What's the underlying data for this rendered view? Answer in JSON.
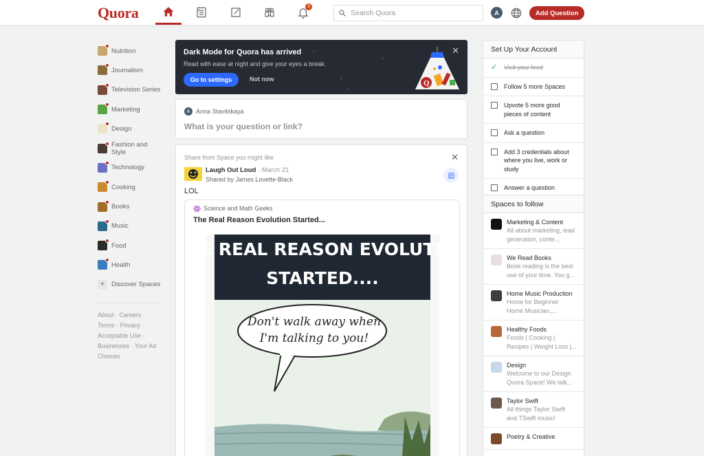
{
  "header": {
    "logo": "Quora",
    "notifications_count": "3",
    "search_placeholder": "Search Quora",
    "avatar_letter": "A",
    "add_question_label": "Add Question"
  },
  "sidebar": {
    "items": [
      {
        "label": "Nutrition",
        "color": "#c9a66b"
      },
      {
        "label": "Journalism",
        "color": "#8a6d3b"
      },
      {
        "label": "Television Series",
        "color": "#7a4b3a"
      },
      {
        "label": "Marketing",
        "color": "#5aa343"
      },
      {
        "label": "Design",
        "color": "#e9e3c9"
      },
      {
        "label": "Fashion and Style",
        "color": "#4a3b34"
      },
      {
        "label": "Technology",
        "color": "#6d6fc4"
      },
      {
        "label": "Cooking",
        "color": "#c88a2e"
      },
      {
        "label": "Books",
        "color": "#a56b2a"
      },
      {
        "label": "Music",
        "color": "#2c6a8f"
      },
      {
        "label": "Food",
        "color": "#2b2b2b"
      },
      {
        "label": "Health",
        "color": "#3b7bbf"
      }
    ],
    "discover_label": "Discover Spaces",
    "footer_links": [
      "About",
      "Careers",
      "Terms",
      "Privacy",
      "Acceptable Use",
      "Businesses",
      "Your Ad Choices"
    ]
  },
  "dark_mode_banner": {
    "title": "Dark Mode for Quora has arrived",
    "description": "Read with ease at night and give your eyes a break.",
    "primary_button": "Go to settings",
    "secondary_button": "Not now"
  },
  "ask_box": {
    "user_name": "Anna Stavitskaya",
    "user_initial": "A",
    "prompt": "What is your question or link?"
  },
  "post": {
    "source": "Share from Space you might like",
    "space_name": "Laugh Out Loud",
    "date": "· March 21",
    "shared_by": "Shared by James Lovette-Black",
    "text": "LOL",
    "inner_space": "Science and Math Geeks",
    "inner_title": "The Real Reason Evolution Started...",
    "comic_caption_line1": "THE REAL REASON EVOLUTION",
    "comic_caption_line2": "STARTED....",
    "comic_bubble_line1": "Don't walk away when",
    "comic_bubble_line2": "I'm talking to you!"
  },
  "setup": {
    "title": "Set Up Your Account",
    "tasks": [
      {
        "label": "Visit your feed",
        "done": true
      },
      {
        "label": "Follow 5 more Spaces",
        "done": false
      },
      {
        "label": "Upvote 5 more good pieces of content",
        "done": false
      },
      {
        "label": "Ask a question",
        "done": false
      },
      {
        "label": "Add 3 credentials about where you live, work or study",
        "done": false
      },
      {
        "label": "Answer a question",
        "done": false
      }
    ]
  },
  "spaces_to_follow": {
    "title": "Spaces to follow",
    "items": [
      {
        "name": "Marketing & Content",
        "desc": "All about marketing, lead generation, conte...",
        "color": "#111111"
      },
      {
        "name": "We Read Books",
        "desc": "Book reading is the best use of your time. You g...",
        "color": "#e8dfe0"
      },
      {
        "name": "Home Music Production",
        "desc": "Home for Beginner Home Musician,...",
        "color": "#3d3d3d"
      },
      {
        "name": "Healthy Foods",
        "desc": "Foods | Cooking | Recipes | Weight Loss |...",
        "color": "#b5673a"
      },
      {
        "name": "Design",
        "desc": "Welcome to our Design Quora Space! We talk...",
        "color": "#c7d8e8"
      },
      {
        "name": "Taylor Swift",
        "desc": "All things Taylor Swift and TSwift music!",
        "color": "#6b5a4e"
      },
      {
        "name": "Poetry & Creative",
        "desc": "",
        "color": "#7a4a2a"
      }
    ]
  }
}
